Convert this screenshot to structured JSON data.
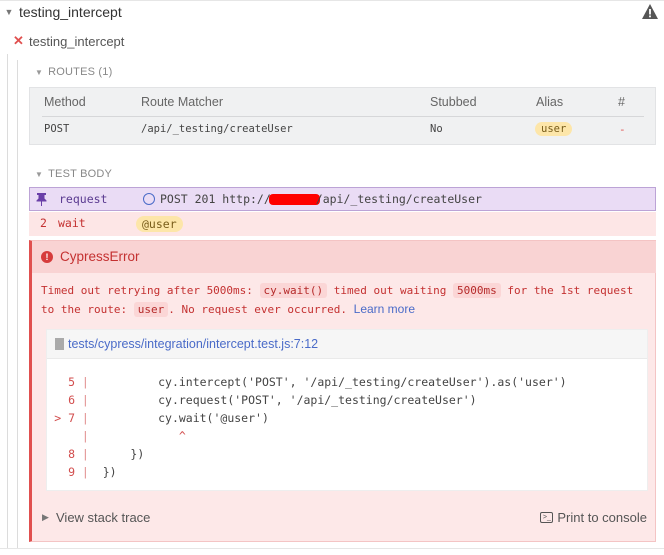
{
  "suite": {
    "title": "testing_intercept"
  },
  "test": {
    "title": "testing_intercept",
    "status_icon": "fail-x-icon"
  },
  "routes": {
    "label": "ROUTES (1)",
    "headers": [
      "Method",
      "Route Matcher",
      "Stubbed",
      "Alias",
      "#"
    ],
    "rows": [
      {
        "method": "POST",
        "matcher": "/api/_testing/createUser",
        "stubbed": "No",
        "alias": "user",
        "count": "-"
      }
    ]
  },
  "test_body": {
    "label": "TEST BODY",
    "commands": [
      {
        "name": "request",
        "msg_before": "POST 201 http://",
        "msg_after": "/api/_testing/createUser"
      },
      {
        "number": "2",
        "name": "wait",
        "alias": "@user"
      }
    ]
  },
  "error": {
    "name": "CypressError",
    "msg_1": "Timed out retrying after 5000ms: ",
    "code_1": "cy.wait()",
    "msg_2": " timed out waiting ",
    "code_2": "5000ms",
    "msg_3": " for the 1st request to the route: ",
    "code_3": "user",
    "msg_4": ". No request ever occurred. ",
    "learn_more": "Learn more",
    "file": "tests/cypress/integration/intercept.test.js:7:12",
    "code_lines": [
      {
        "prefix": "  ",
        "num": "5",
        "code": "         cy.intercept('POST', '/api/_testing/createUser').as('user')"
      },
      {
        "prefix": "  ",
        "num": "6",
        "code": "         cy.request('POST', '/api/_testing/createUser')"
      },
      {
        "prefix": "> ",
        "num": "7",
        "code": "         cy.wait('@user')"
      },
      {
        "prefix": "  ",
        "num": "",
        "code": "            ^"
      },
      {
        "prefix": "  ",
        "num": "8",
        "code": "     })"
      },
      {
        "prefix": "  ",
        "num": "9",
        "code": " })"
      }
    ],
    "stack_trace": "View stack trace",
    "print_console": "Print to console"
  },
  "colors": {
    "fail": "#e0504f",
    "alias_bg": "#fde6a9",
    "link": "#4a6bc8",
    "pinned_bg": "#eadcf5"
  }
}
